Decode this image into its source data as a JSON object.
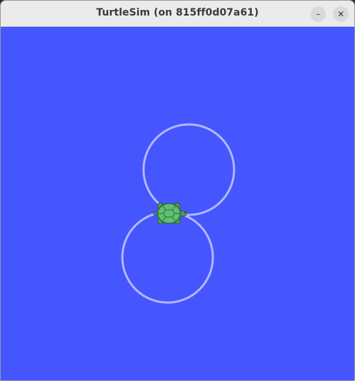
{
  "window": {
    "title": "TurtleSim (on 815ff0d07a61)",
    "minimize_symbol": "–",
    "close_symbol": "✕"
  },
  "canvas": {
    "background_color": "#4556ff",
    "pen_color": "#b3b8ff",
    "turtle_icon": "turtle-icon",
    "turtle_shell_color": "#5fbf72",
    "turtle_skin_color": "#4f9a57"
  }
}
